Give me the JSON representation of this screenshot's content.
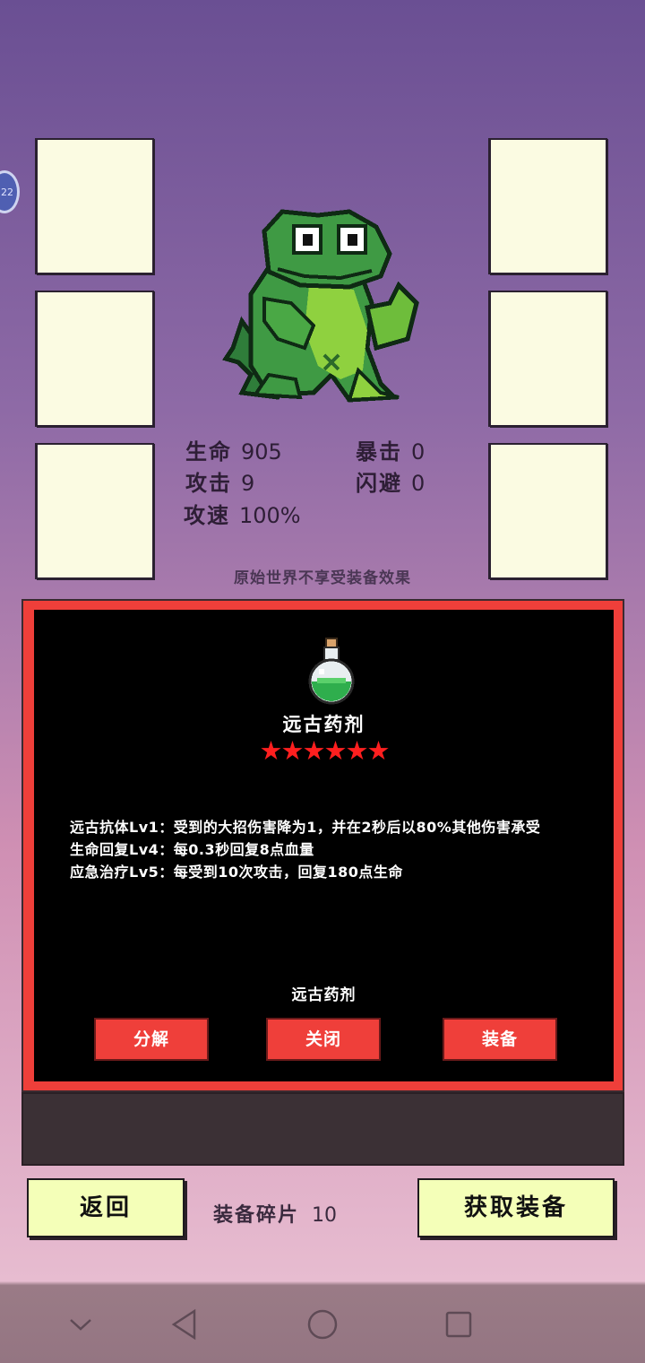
{
  "hero": {
    "stats": {
      "hp_label": "生命",
      "hp_value": "905",
      "crit_label": "暴击",
      "crit_value": "0",
      "atk_label": "攻击",
      "atk_value": "9",
      "dodge_label": "闪避",
      "dodge_value": "0",
      "speed_label": "攻速",
      "speed_value": "100%"
    },
    "notice": "原始世界不享受装备效果"
  },
  "avatar_badge": "22",
  "item_panel": {
    "icon": "green-potion-icon",
    "title": "远古药剂",
    "stars": "★★★★★★",
    "star_count": 6,
    "description": [
      "远古抗体Lv1：受到的大招伤害降为1，并在2秒后以80%其他伤害承受",
      "生命回复Lv4：每0.3秒回复8点血量",
      "应急治疗Lv5：每受到10次攻击，回复180点生命"
    ],
    "item_name": "远古药剂",
    "buttons": {
      "decompose": "分解",
      "close": "关闭",
      "equip": "装备"
    }
  },
  "bottom": {
    "back_label": "返回",
    "fragments_label": "装备碎片",
    "fragments_value": "10",
    "get_equipment_label": "获取装备"
  },
  "colors": {
    "panel_border": "#ef3f3a",
    "star": "#ff1f1f",
    "yellow_button": "#f4ffb8",
    "slot": "#fbfbe2"
  },
  "navbar": {
    "icons": [
      "chevron-down-icon",
      "back-icon",
      "home-icon",
      "recents-icon"
    ]
  }
}
